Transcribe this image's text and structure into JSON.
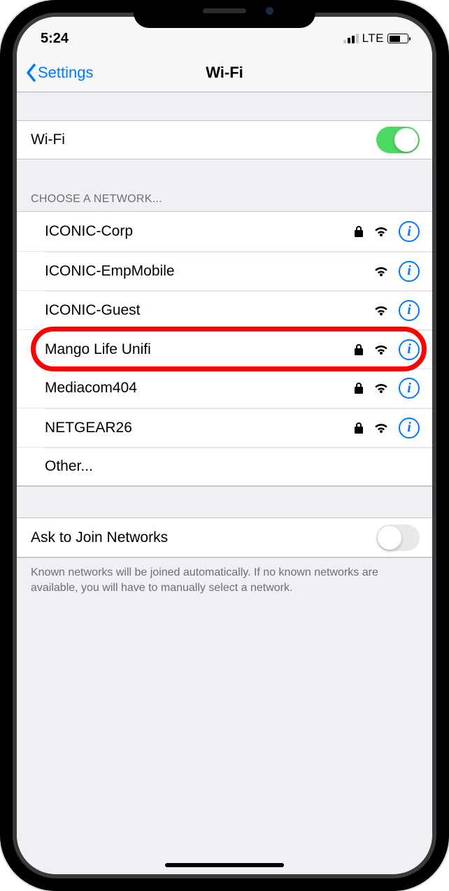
{
  "status": {
    "time": "5:24",
    "carrier": "LTE"
  },
  "nav": {
    "back_label": "Settings",
    "title": "Wi-Fi"
  },
  "wifi_toggle": {
    "label": "Wi-Fi",
    "on": true
  },
  "section_header": "Choose a Network...",
  "networks": [
    {
      "name": "ICONIC-Corp",
      "locked": true,
      "highlighted": false
    },
    {
      "name": "ICONIC-EmpMobile",
      "locked": false,
      "highlighted": false
    },
    {
      "name": "ICONIC-Guest",
      "locked": false,
      "highlighted": false
    },
    {
      "name": "Mango Life Unifi",
      "locked": true,
      "highlighted": true
    },
    {
      "name": "Mediacom404",
      "locked": true,
      "highlighted": false
    },
    {
      "name": "NETGEAR26",
      "locked": true,
      "highlighted": false
    }
  ],
  "other_label": "Other...",
  "ask": {
    "label": "Ask to Join Networks",
    "on": false,
    "description": "Known networks will be joined automatically. If no known networks are available, you will have to manually select a network."
  }
}
